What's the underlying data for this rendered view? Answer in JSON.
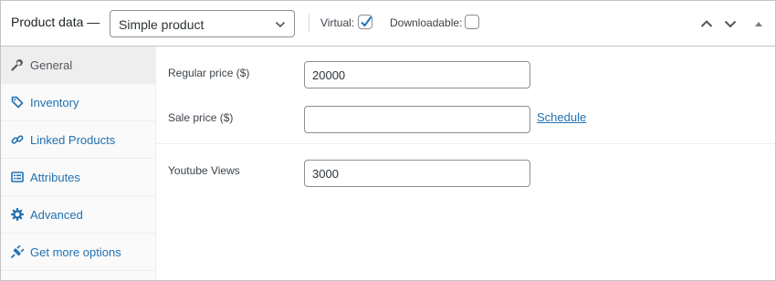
{
  "header": {
    "title": "Product data —",
    "product_type": {
      "selected": "Simple product",
      "options": [
        "Simple product"
      ]
    },
    "virtual": {
      "label": "Virtual:",
      "checked": true
    },
    "downloadable": {
      "label": "Downloadable:",
      "checked": false
    },
    "controls": [
      "chevron-up-icon",
      "chevron-down-icon",
      "triangle-up-icon"
    ]
  },
  "sidebar": {
    "items": [
      {
        "label": "General",
        "icon": "wrench-icon",
        "active": true
      },
      {
        "label": "Inventory",
        "icon": "tag-icon",
        "active": false
      },
      {
        "label": "Linked Products",
        "icon": "link-icon",
        "active": false
      },
      {
        "label": "Attributes",
        "icon": "list-icon",
        "active": false
      },
      {
        "label": "Advanced",
        "icon": "gear-icon",
        "active": false
      },
      {
        "label": "Get more options",
        "icon": "plug-icon",
        "active": false
      }
    ]
  },
  "main": {
    "regular_price": {
      "label": "Regular price ($)",
      "value": "20000"
    },
    "sale_price": {
      "label": "Sale price ($)",
      "value": "",
      "schedule_link": "Schedule"
    },
    "youtube_views": {
      "label": "Youtube Views",
      "value": "3000"
    }
  },
  "colors": {
    "link": "#2271b1",
    "border": "#c3c4c7",
    "sidebar_bg": "#fafafa",
    "active_tab_bg": "#eeeeee"
  }
}
